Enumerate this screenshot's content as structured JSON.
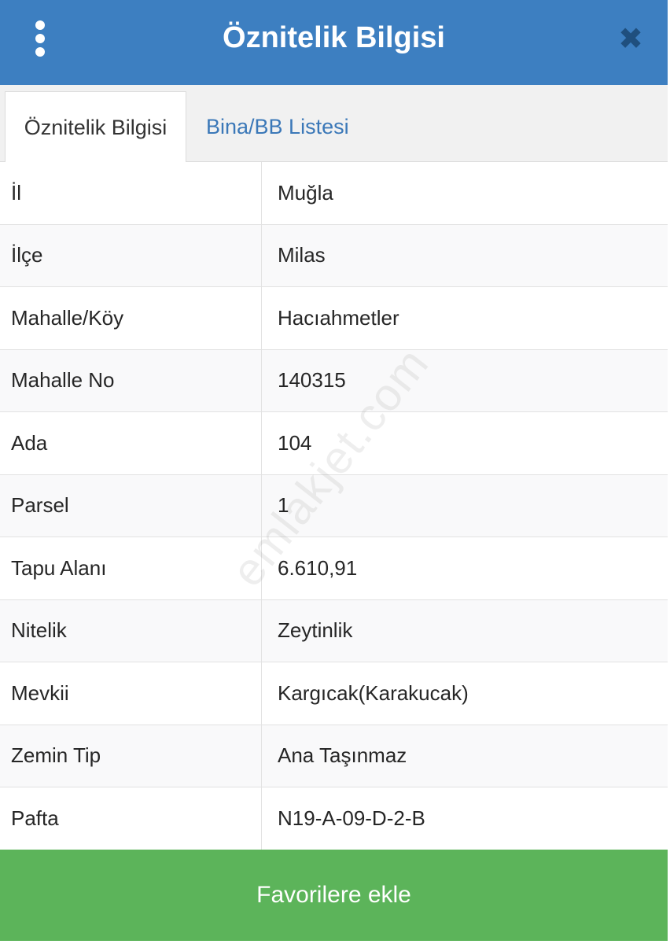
{
  "header": {
    "title": "Öznitelik Bilgisi",
    "menu_icon": "kebab-vertical-icon",
    "close_icon": "close-icon",
    "close_glyph": "✖",
    "color": "#3d7fc1"
  },
  "tabs": [
    {
      "label": "Öznitelik Bilgisi",
      "active": true
    },
    {
      "label": "Bina/BB Listesi",
      "active": false
    }
  ],
  "attributes": [
    {
      "key": "İl",
      "value": "Muğla"
    },
    {
      "key": "İlçe",
      "value": "Milas"
    },
    {
      "key": "Mahalle/Köy",
      "value": "Hacıahmetler"
    },
    {
      "key": "Mahalle No",
      "value": "140315"
    },
    {
      "key": "Ada",
      "value": "104"
    },
    {
      "key": "Parsel",
      "value": "1"
    },
    {
      "key": "Tapu Alanı",
      "value": "6.610,91"
    },
    {
      "key": "Nitelik",
      "value": "Zeytinlik"
    },
    {
      "key": "Mevkii",
      "value": "Kargıcak(Karakucak)"
    },
    {
      "key": "Zemin Tip",
      "value": "Ana Taşınmaz"
    },
    {
      "key": "Pafta",
      "value": "N19-A-09-D-2-B"
    }
  ],
  "watermark": "emlakjet.com",
  "footer": {
    "button_label": "Favorilere ekle",
    "color": "#5cb45a"
  }
}
